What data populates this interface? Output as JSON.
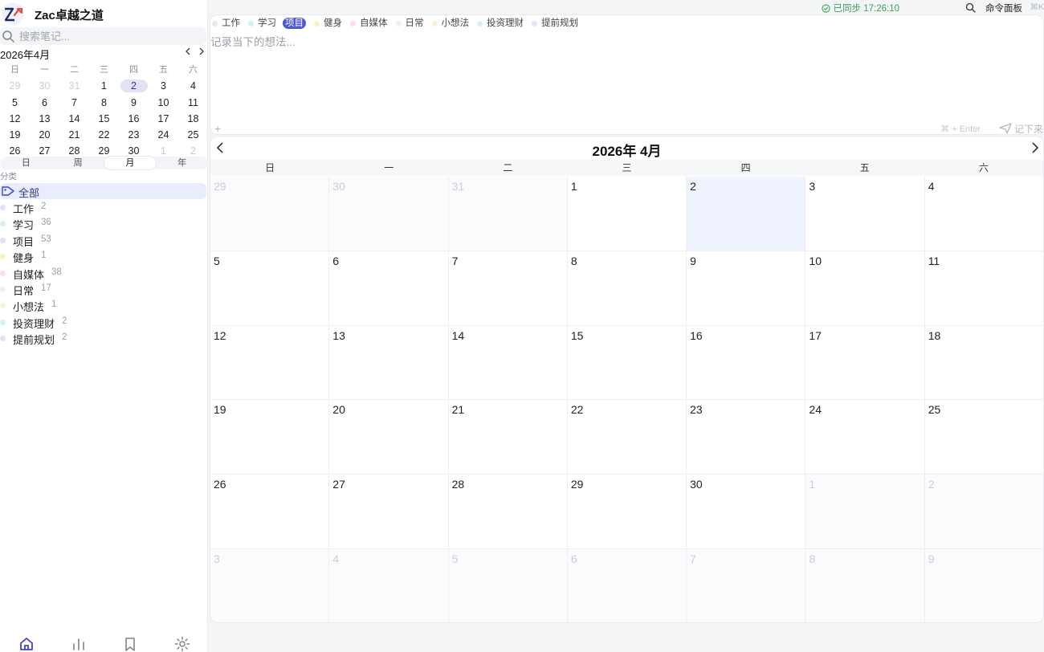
{
  "app": {
    "name": "Zac卓越之道"
  },
  "status": {
    "sync_text": "已同步 17:26:10",
    "command_label": "命令面板",
    "command_key": "⌘K"
  },
  "sidebar": {
    "search_placeholder": "搜索笔记...",
    "mini_calendar": {
      "title": "2026年4月",
      "weekdays": [
        "日",
        "一",
        "二",
        "三",
        "四",
        "五",
        "六"
      ],
      "weeks": [
        [
          "29",
          "30",
          "31",
          "1",
          "2",
          "3",
          "4"
        ],
        [
          "5",
          "6",
          "7",
          "8",
          "9",
          "10",
          "11"
        ],
        [
          "12",
          "13",
          "14",
          "15",
          "16",
          "17",
          "18"
        ],
        [
          "19",
          "20",
          "21",
          "22",
          "23",
          "24",
          "25"
        ],
        [
          "26",
          "27",
          "28",
          "29",
          "30",
          "1",
          "2"
        ]
      ]
    },
    "views": [
      "日",
      "周",
      "月",
      "年"
    ],
    "active_view": "月",
    "categories_label": "分类",
    "all_label": "全部",
    "categories": [
      {
        "name": "工作",
        "count": "2",
        "color": "#dfe3f5"
      },
      {
        "name": "学习",
        "count": "36",
        "color": "#d7f2e3"
      },
      {
        "name": "项目",
        "count": "53",
        "color": "#dfe3f5"
      },
      {
        "name": "健身",
        "count": "1",
        "color": "#fbf0c2"
      },
      {
        "name": "自媒体",
        "count": "38",
        "color": "#fbe1e6"
      },
      {
        "name": "日常",
        "count": "17",
        "color": "#eef0f3"
      },
      {
        "name": "小想法",
        "count": "1",
        "color": "#fbf3c8"
      },
      {
        "name": "投资理财",
        "count": "2",
        "color": "#d7f2e3"
      },
      {
        "name": "提前规划",
        "count": "2",
        "color": "#e6e1fa"
      }
    ]
  },
  "composer": {
    "tags": [
      {
        "name": "工作",
        "color": "#e4e7ee"
      },
      {
        "name": "学习",
        "color": "#d7f2e3"
      },
      {
        "name": "项目",
        "color": "#4f58d3"
      },
      {
        "name": "健身",
        "color": "#fbf0c2"
      },
      {
        "name": "自媒体",
        "color": "#fbe1e6"
      },
      {
        "name": "日常",
        "color": "#eef0f3"
      },
      {
        "name": "小想法",
        "color": "#fbf3c8"
      },
      {
        "name": "投资理财",
        "color": "#d7f2e3"
      },
      {
        "name": "提前规划",
        "color": "#e6e1fa"
      }
    ],
    "active_tag": "项目",
    "placeholder": "记录当下的想法...",
    "plus": "+",
    "enter_hint": "⌘ + Enter",
    "send_label": "记下来"
  },
  "calendar": {
    "title": "2026年 4月",
    "weekdays": [
      "日",
      "一",
      "二",
      "三",
      "四",
      "五",
      "六"
    ],
    "weeks": [
      [
        "29",
        "30",
        "31",
        "1",
        "2",
        "3",
        "4"
      ],
      [
        "5",
        "6",
        "7",
        "8",
        "9",
        "10",
        "11"
      ],
      [
        "12",
        "13",
        "14",
        "15",
        "16",
        "17",
        "18"
      ],
      [
        "19",
        "20",
        "21",
        "22",
        "23",
        "24",
        "25"
      ],
      [
        "26",
        "27",
        "28",
        "29",
        "30",
        "1",
        "2"
      ],
      [
        "3",
        "4",
        "5",
        "6",
        "7",
        "8",
        "9"
      ]
    ],
    "today": "2"
  }
}
